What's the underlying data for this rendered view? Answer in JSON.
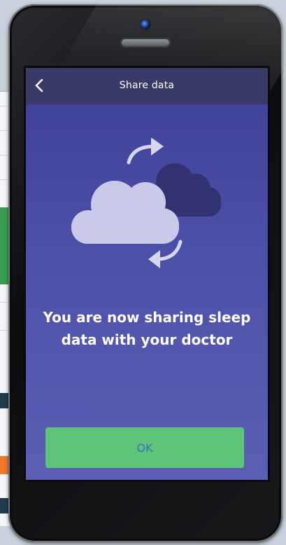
{
  "header": {
    "title": "Share data",
    "back_icon": "chevron-left-icon"
  },
  "illustration": {
    "icons": [
      "cloud-sync-icon",
      "arrow-right-curved-icon",
      "arrow-left-curved-icon"
    ],
    "front_cloud_color": "#c9c9ea",
    "back_cloud_color": "#323270"
  },
  "main": {
    "message_line1": "You are now sharing sleep",
    "message_line2": "data with your doctor"
  },
  "actions": {
    "ok_label": "OK"
  },
  "colors": {
    "background_top": "#3f3f97",
    "background_bottom": "#5b5fb3",
    "header_bar": "#3a3a68",
    "button": "#5ec47a",
    "button_text": "#3e6ec0"
  }
}
